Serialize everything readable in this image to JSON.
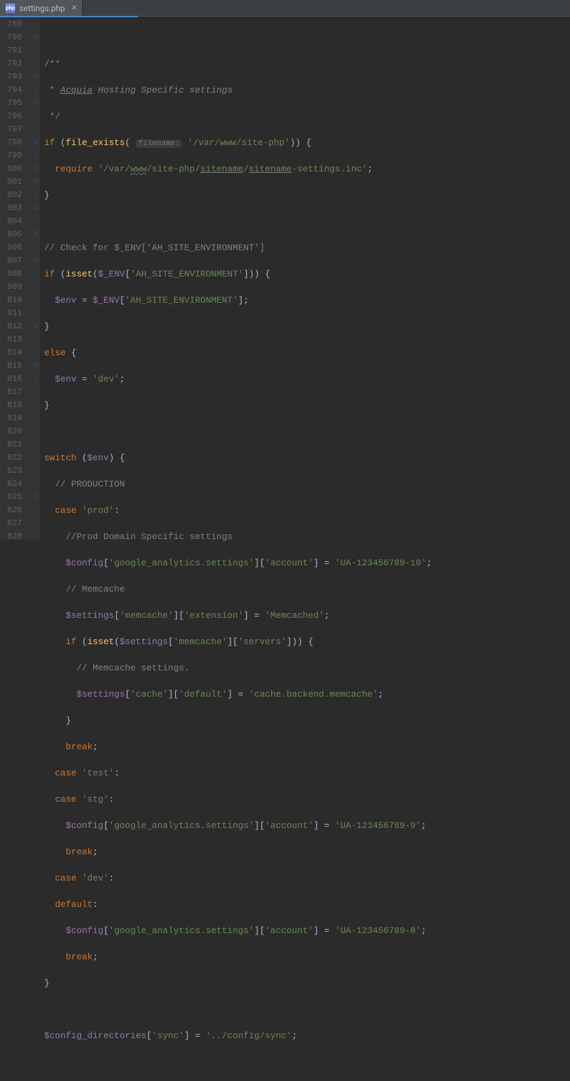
{
  "tab": {
    "filename": "settings.php",
    "icon_label": "php"
  },
  "line_numbers": [
    "789",
    "790",
    "791",
    "792",
    "793",
    "794",
    "795",
    "796",
    "797",
    "798",
    "799",
    "800",
    "801",
    "802",
    "803",
    "804",
    "805",
    "806",
    "807",
    "808",
    "809",
    "810",
    "811",
    "812",
    "813",
    "814",
    "815",
    "816",
    "817",
    "818",
    "819",
    "820",
    "821",
    "822",
    "823",
    "824",
    "825",
    "826",
    "827",
    "828"
  ],
  "inline_hint": "filename:",
  "l790": "/**",
  "l790b": " * ",
  "l790c": "Acquia",
  " l790d": " Hosting Specific settings",
  "l791": " * ",
  "l791b": "Acquia",
  "l791c": " Hosting Specific settings",
  "l792": " */",
  "l793_if": "if ",
  "l793_fe": "file_exists",
  "l793_path": "'/var/www/site-php'",
  "l793_brace": ")) {",
  "l794_req": "require ",
  "l794_s1": "'/var/",
  "l794_www": "www",
  "l794_s2": "/site-php/",
  "l794_sn1": "sitename",
  "l794_s3": "/",
  "l794_sn2": "sitename",
  "l794_s4": "-settings.inc'",
  "l797": "// Check for $_ENV['AH_SITE_ENVIRONMENT']",
  "l798_if": "if ",
  "l798_isset": "isset",
  "l798_env": "$_ENV",
  "l798_key": "'AH_SITE_ENVIRONMENT'",
  "l799_env": "$env",
  "l799_geq": " = ",
  "l799_genv": "$_ENV",
  "l799_key": "'AH_SITE_ENVIRONMENT'",
  "l801_else": "else ",
  "l802_env": "$env",
  "l802_dev": "'dev'",
  "l805_switch": "switch ",
  "l805_env": "$env",
  "l806": "// PRODUCTION",
  "l807_case": "case ",
  "l807_prod": "'prod'",
  "l808": "//Prod Domain Specific settings",
  "l809_cfg": "$config",
  "l809_k1": "'google_analytics.settings'",
  "l809_k2": "'account'",
  "l809_v": "'UA-123456789-10'",
  "l810": "// Memcache",
  "l811_set": "$settings",
  "l811_k1": "'memcache'",
  "l811_k2": "'extension'",
  "l811_v": "'Memcached'",
  "l812_if": "if ",
  "l812_isset": "isset",
  "l812_set": "$settings",
  "l812_k1": "'memcache'",
  "l812_k2": "'servers'",
  "l813": "// Memcache settings.",
  "l814_set": "$settings",
  "l814_k1": "'cache'",
  "l814_k2": "'default'",
  "l814_v": "'cache.backend.memcache'",
  "l816_break": "break",
  "l817_case": "case ",
  "l817_test": "'test'",
  "l818_case": "case ",
  "l818_stg": "'stg'",
  "l819_cfg": "$config",
  "l819_k1": "'google_analytics.settings'",
  "l819_k2": "'account'",
  "l819_v": "'UA-123456789-9'",
  "l820_break": "break",
  "l821_case": "case ",
  "l821_dev": "'dev'",
  "l822_default": "default",
  "l823_cfg": "$config",
  "l823_k1": "'google_analytics.settings'",
  "l823_k2": "'account'",
  "l823_v": "'UA-123456789-8'",
  "l824_break": "break",
  "l827_cd": "$config_directories",
  "l827_k": "'sync'",
  "l827_v": "'../config/sync'"
}
